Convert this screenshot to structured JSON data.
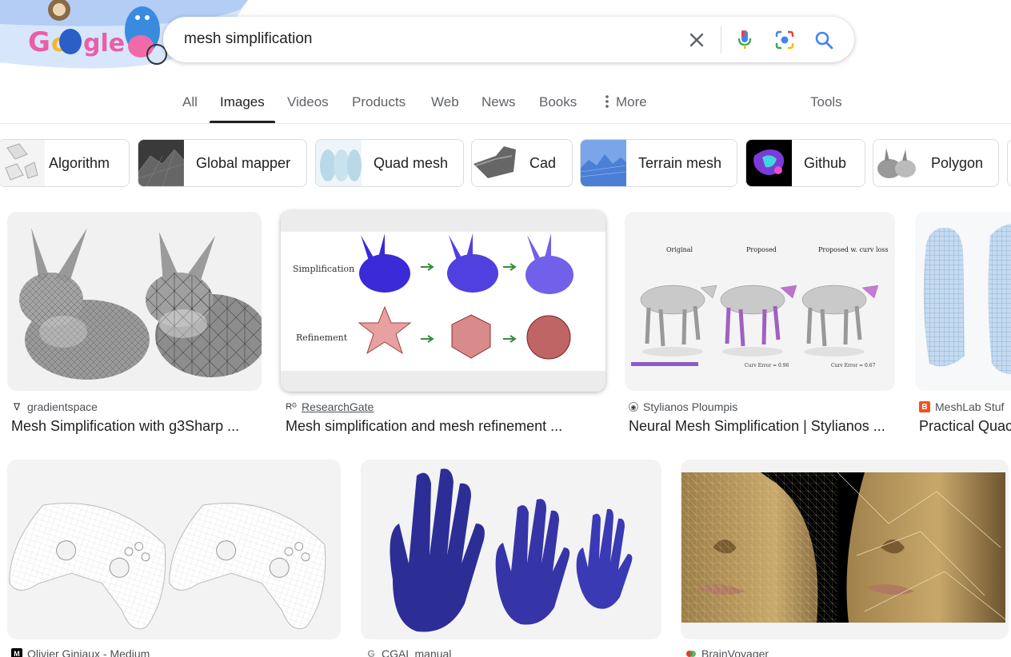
{
  "search": {
    "query": "mesh simplification"
  },
  "tabs": [
    {
      "label": "All"
    },
    {
      "label": "Images"
    },
    {
      "label": "Videos"
    },
    {
      "label": "Products"
    },
    {
      "label": "Web"
    },
    {
      "label": "News"
    },
    {
      "label": "Books"
    },
    {
      "label": "More"
    },
    {
      "label": "Tools"
    }
  ],
  "chips": [
    {
      "label": "Algorithm"
    },
    {
      "label": "Global mapper"
    },
    {
      "label": "Quad mesh"
    },
    {
      "label": "Cad"
    },
    {
      "label": "Terrain mesh"
    },
    {
      "label": "Github"
    },
    {
      "label": "Polygon"
    }
  ],
  "results": [
    {
      "source": "gradientspace",
      "title": "Mesh Simplification with g3Sharp ..."
    },
    {
      "source": "ResearchGate",
      "title": "Mesh simplification and mesh refinement ...",
      "figure": {
        "row1": "Simplification",
        "row2": "Refinement"
      }
    },
    {
      "source": "Stylianos Ploumpis",
      "title": "Neural Mesh Simplification | Stylianos ...",
      "figure": {
        "col1": "Original",
        "col2": "Proposed",
        "col3": "Proposed w. curv loss",
        "err1": "Curv Error = 0.96",
        "err2": "Curv Error = 0.67"
      }
    },
    {
      "source": "MeshLab Stuf",
      "title": "Practical Quac"
    },
    {
      "source": "Olivier Giniaux - Medium",
      "title": ""
    },
    {
      "source": "CGAL manual",
      "title": ""
    },
    {
      "source": "BrainVoyager",
      "title": ""
    }
  ],
  "colors": {
    "accent_blue": "#4285f4",
    "text": "#202124",
    "muted": "#5f6368"
  }
}
